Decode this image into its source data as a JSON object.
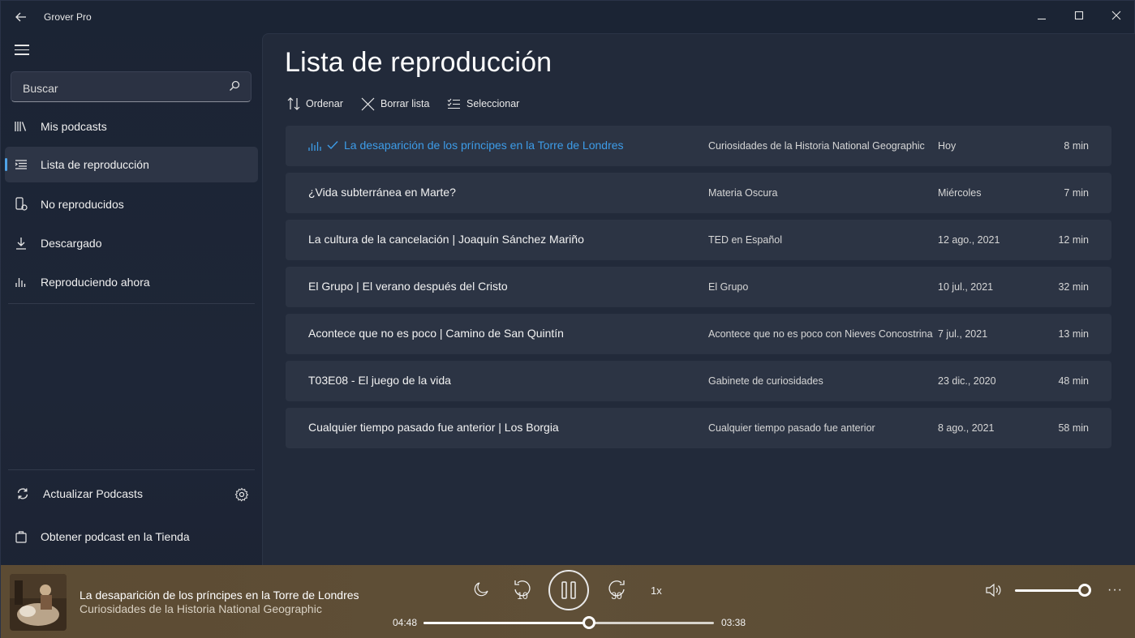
{
  "app": {
    "title": "Grover Pro"
  },
  "sidebar": {
    "search_placeholder": "Buscar",
    "items": [
      {
        "label": "Mis podcasts",
        "icon": "library-icon"
      },
      {
        "label": "Lista de reproducción",
        "icon": "playlist-icon",
        "active": true
      },
      {
        "label": "No reproducidos",
        "icon": "unplayed-icon"
      },
      {
        "label": "Descargado",
        "icon": "download-icon"
      },
      {
        "label": "Reproduciendo ahora",
        "icon": "equalizer-icon"
      }
    ],
    "footer": {
      "refresh_label": "Actualizar Podcasts",
      "store_label": "Obtener podcast en la Tienda"
    }
  },
  "main": {
    "title": "Lista de reproducción",
    "commands": {
      "sort": "Ordenar",
      "clear": "Borrar lista",
      "select": "Seleccionar"
    },
    "episodes": [
      {
        "title": "La desaparición de los príncipes en la Torre de Londres",
        "podcast": "Curiosidades de la Historia National Geographic",
        "date": "Hoy",
        "duration": "8 min",
        "playing": true
      },
      {
        "title": "¿Vida subterránea en Marte?",
        "podcast": "Materia Oscura",
        "date": "Miércoles",
        "duration": "7 min"
      },
      {
        "title": "La cultura de la cancelación | Joaquín Sánchez Mariño",
        "podcast": "TED en Español",
        "date": "12 ago., 2021",
        "duration": "12 min"
      },
      {
        "title": "El Grupo | El verano después del Cristo",
        "podcast": "El Grupo",
        "date": "10 jul., 2021",
        "duration": "32 min"
      },
      {
        "title": "Acontece que no es poco | Camino de San Quintín",
        "podcast": "Acontece que no es poco con Nieves Concostrina",
        "date": "7 jul., 2021",
        "duration": "13 min"
      },
      {
        "title": "T03E08 - El juego de la vida",
        "podcast": "Gabinete de curiosidades",
        "date": "23 dic., 2020",
        "duration": "48 min"
      },
      {
        "title": "Cualquier tiempo pasado fue anterior | Los Borgia",
        "podcast": "Cualquier tiempo pasado fue anterior",
        "date": "8 ago., 2021",
        "duration": "58 min"
      }
    ]
  },
  "player": {
    "title": "La desaparición de los príncipes en la Torre de Londres",
    "podcast": "Curiosidades de la Historia National Geographic",
    "elapsed": "04:48",
    "remaining": "03:38",
    "progress": 0.57,
    "volume": 1.0,
    "skip_back": "10",
    "skip_forward": "30",
    "speed": "1x",
    "more": "···"
  },
  "colors": {
    "accent": "#3d9ce8",
    "player_bg": "#5d4d35",
    "main_bg": "#222a3a",
    "row_bg": "#2c3444"
  }
}
